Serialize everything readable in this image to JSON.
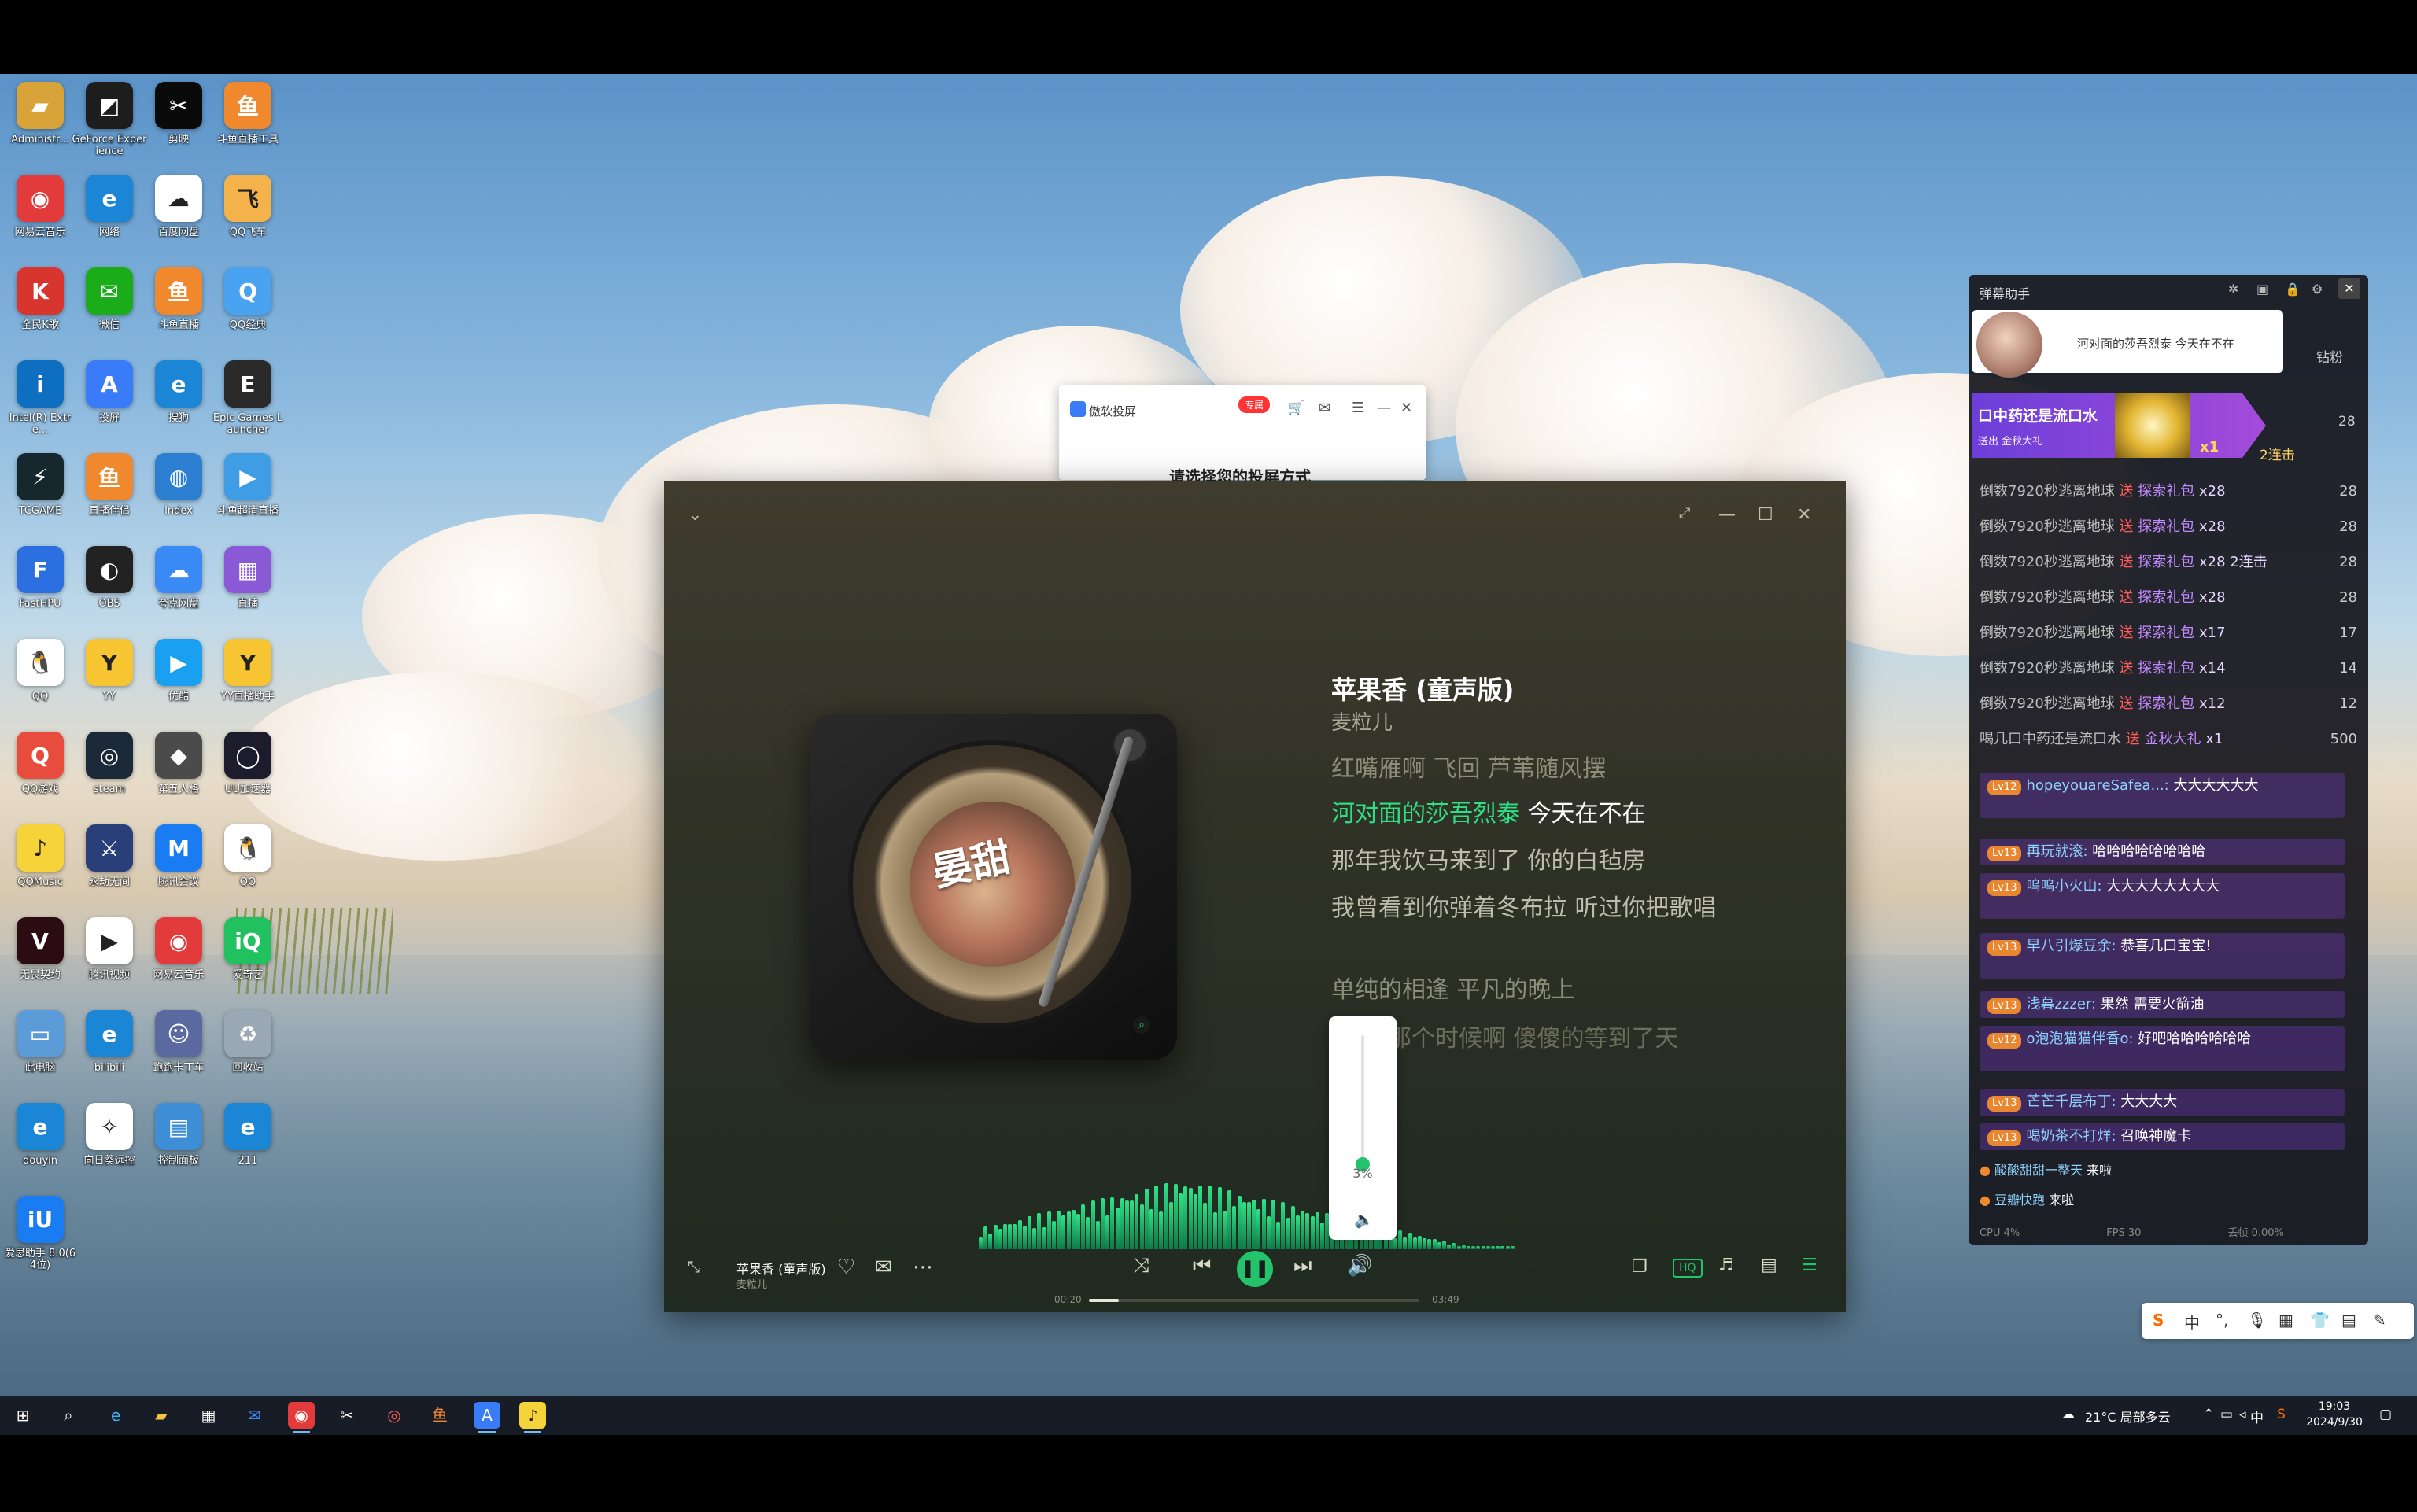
{
  "desktop_icons": [
    {
      "label": "Administr...",
      "icon": "folder-icon",
      "color": "#d8a43a",
      "glyph": "▰"
    },
    {
      "label": "GeForce Experience",
      "icon": "geforce-icon",
      "color": "#1d1d1d",
      "glyph": "◩"
    },
    {
      "label": "剪映",
      "icon": "capcut-icon",
      "color": "#0a0a0a",
      "glyph": "✂"
    },
    {
      "label": "斗鱼直播工具",
      "icon": "douyu-tool-icon",
      "color": "#f0892e",
      "glyph": "鱼"
    },
    {
      "label": "网易云音乐",
      "icon": "netease-music-icon",
      "color": "#e33b3b",
      "glyph": "◉"
    },
    {
      "label": "网络",
      "icon": "edge-icon",
      "color": "#1c86d6",
      "glyph": "e"
    },
    {
      "label": "百度网盘",
      "icon": "baidu-pan-icon",
      "color": "#ffffff",
      "glyph": "☁"
    },
    {
      "label": "QQ飞车",
      "icon": "qq-speed-icon",
      "color": "#f4b24a",
      "glyph": "飞"
    },
    {
      "label": "全民K歌",
      "icon": "game-icon",
      "color": "#d8352f",
      "glyph": "K"
    },
    {
      "label": "微信",
      "icon": "wechat-icon",
      "color": "#1aad19",
      "glyph": "✉"
    },
    {
      "label": "斗鱼直播",
      "icon": "douyu-icon",
      "color": "#f0892e",
      "glyph": "鱼"
    },
    {
      "label": "QQ经典",
      "icon": "qq-classic-icon",
      "color": "#4aa3f0",
      "glyph": "Q"
    },
    {
      "label": "Intel(R) Extre...",
      "icon": "intel-icon",
      "color": "#0e6fc1",
      "glyph": "i"
    },
    {
      "label": "投屏",
      "icon": "cast-icon",
      "color": "#3a7bf7",
      "glyph": "A"
    },
    {
      "label": "搜狗",
      "icon": "edge-icon",
      "color": "#1c86d6",
      "glyph": "e"
    },
    {
      "label": "Epic Games Launcher",
      "icon": "epic-icon",
      "color": "#2a2a2a",
      "glyph": "E"
    },
    {
      "label": "TCGAME",
      "icon": "tcgame-icon",
      "color": "#16282e",
      "glyph": "⚡"
    },
    {
      "label": "直播伴侣",
      "icon": "douyu-icon",
      "color": "#f0892e",
      "glyph": "鱼"
    },
    {
      "label": "Index",
      "icon": "globe-icon",
      "color": "#2c7fd0",
      "glyph": "◍"
    },
    {
      "label": "斗鱼超清直播",
      "icon": "stream-icon",
      "color": "#3f9de6",
      "glyph": "▶"
    },
    {
      "label": "FastHPU",
      "icon": "fast-icon",
      "color": "#2b6fe0",
      "glyph": "F"
    },
    {
      "label": "OBS",
      "icon": "obs-icon",
      "color": "#222222",
      "glyph": "◐"
    },
    {
      "label": "夸克网盘",
      "icon": "cloud-drive-icon",
      "color": "#3a8af5",
      "glyph": "☁"
    },
    {
      "label": "直播",
      "icon": "live-icon",
      "color": "#8a5ad6",
      "glyph": "▦"
    },
    {
      "label": "QQ",
      "icon": "qq-icon",
      "color": "#ffffff",
      "glyph": "🐧"
    },
    {
      "label": "YY",
      "icon": "yy-icon",
      "color": "#f6c531",
      "glyph": "Y"
    },
    {
      "label": "优酷",
      "icon": "video-icon",
      "color": "#1aa0f0",
      "glyph": "▶"
    },
    {
      "label": "YY直播助手",
      "icon": "yy-helper-icon",
      "color": "#f6c531",
      "glyph": "Y"
    },
    {
      "label": "QQ游戏",
      "icon": "qq-game-icon",
      "color": "#e74c3c",
      "glyph": "Q"
    },
    {
      "label": "steam",
      "icon": "steam-icon",
      "color": "#1b2838",
      "glyph": "◎"
    },
    {
      "label": "第五人格",
      "icon": "game-icon",
      "color": "#4b4b4b",
      "glyph": "◆"
    },
    {
      "label": "UU加速器",
      "icon": "uu-icon",
      "color": "#1c1c2c",
      "glyph": "◯"
    },
    {
      "label": "QQMusic",
      "icon": "qq-music-icon",
      "color": "#f7d33a",
      "glyph": "♪"
    },
    {
      "label": "永劫无间",
      "icon": "game-icon",
      "color": "#2a3f7a",
      "glyph": "⚔"
    },
    {
      "label": "腾讯会议",
      "icon": "meeting-icon",
      "color": "#1a7cf3",
      "glyph": "M"
    },
    {
      "label": "QQ",
      "icon": "qq-icon",
      "color": "#ffffff",
      "glyph": "🐧"
    },
    {
      "label": "无畏契约",
      "icon": "valorant-icon",
      "color": "#2a0c12",
      "glyph": "V"
    },
    {
      "label": "腾讯视频",
      "icon": "tencent-video-icon",
      "color": "#ffffff",
      "glyph": "▶"
    },
    {
      "label": "网易云音乐",
      "icon": "netease-music-icon",
      "color": "#e33b3b",
      "glyph": "◉"
    },
    {
      "label": "爱奇艺",
      "icon": "iqiyi-icon",
      "color": "#21c160",
      "glyph": "iQ"
    },
    {
      "label": "此电脑",
      "icon": "computer-icon",
      "color": "#5a9bd8",
      "glyph": "▭"
    },
    {
      "label": "bilibili",
      "icon": "edge-icon",
      "color": "#1c86d6",
      "glyph": "e"
    },
    {
      "label": "跑跑卡丁车",
      "icon": "kart-icon",
      "color": "#5a6aa0",
      "glyph": "☺"
    },
    {
      "label": "回收站",
      "icon": "recycle-bin-icon",
      "color": "#9aa7b5",
      "glyph": "♻"
    },
    {
      "label": "douyin",
      "icon": "edge-icon",
      "color": "#1c86d6",
      "glyph": "e"
    },
    {
      "label": "向日葵远控",
      "icon": "remote-icon",
      "color": "#ffffff",
      "glyph": "✧"
    },
    {
      "label": "控制面板",
      "icon": "control-panel-icon",
      "color": "#3e8ed6",
      "glyph": "▤"
    },
    {
      "label": "211",
      "icon": "edge-icon",
      "color": "#1c86d6",
      "glyph": "e"
    },
    {
      "label": "爱思助手 8.0(64位)",
      "icon": "i4-icon",
      "color": "#1a7cf3",
      "glyph": "iU"
    }
  ],
  "popup": {
    "title": "傲软投屏",
    "badge": "专属",
    "body": "请选择您的投屏方式"
  },
  "player": {
    "song_title": "苹果香 (童声版)",
    "artist": "麦粒儿",
    "record_text": "晏甜",
    "lyrics": [
      {
        "text": "红嘴雁啊 飞回  芦苇随风摆",
        "state": "dim"
      },
      {
        "text_hl": "河对面的莎吾烈泰",
        "text_rest": " 今天在不在",
        "state": "active"
      },
      {
        "text": "那年我饮马来到了 你的白毡房",
        "state": "next"
      },
      {
        "text": "我曾看到你弹着冬布拉 听过你把歌唱",
        "state": "next"
      },
      {
        "text": "单纯的相逢 平凡的晚上",
        "state": "dim"
      },
      {
        "text": "那个时候啊 傻傻的等到了天",
        "state": "fade"
      }
    ],
    "volume": {
      "percent_label": "3%",
      "level": 0.03
    },
    "mini_title": "苹果香 (童声版)",
    "mini_artist": "麦粒儿",
    "time_current": "00:20",
    "time_total": "03:49",
    "progress": 0.09,
    "hq_label": "HQ",
    "accent": "#22c36a"
  },
  "danmaku": {
    "title": "弹幕助手",
    "banner_text": "河对面的莎吾烈泰 今天在不在",
    "side_label": "钻粉",
    "gift_banner": {
      "line1": "口中药还是流口水",
      "line2": "送出  金秋大礼",
      "count": "x1",
      "combo": "2连击",
      "side": "28"
    },
    "gift_rows": [
      {
        "user": "倒数7920秒逃离地球",
        "action": "送",
        "gift": "探索礼包",
        "count": "x28",
        "rank": "28"
      },
      {
        "user": "倒数7920秒逃离地球",
        "action": "送",
        "gift": "探索礼包",
        "count": "x28",
        "rank": "28"
      },
      {
        "user": "倒数7920秒逃离地球",
        "action": "送",
        "gift": "探索礼包",
        "count": "x28 2连击",
        "rank": "28"
      },
      {
        "user": "倒数7920秒逃离地球",
        "action": "送",
        "gift": "探索礼包",
        "count": "x28",
        "rank": "28"
      },
      {
        "user": "倒数7920秒逃离地球",
        "action": "送",
        "gift": "探索礼包",
        "count": "x17",
        "rank": "17"
      },
      {
        "user": "倒数7920秒逃离地球",
        "action": "送",
        "gift": "探索礼包",
        "count": "x14",
        "rank": "14"
      },
      {
        "user": "倒数7920秒逃离地球",
        "action": "送",
        "gift": "探索礼包",
        "count": "x12",
        "rank": "12"
      },
      {
        "user": "喝几口中药还是流口水",
        "action": "送",
        "gift": "金秋大礼",
        "count": "x1",
        "rank": "500"
      }
    ],
    "chats": [
      {
        "badge": "Lv12",
        "name": "hopeyouareSafea...:",
        "msg": " 大大大大大大"
      },
      {
        "badge": "Lv13",
        "name": "再玩就滚:",
        "msg": " 哈哈哈哈哈哈哈哈"
      },
      {
        "badge": "Lv13",
        "name": "呜呜小火山:",
        "msg": " 大大大大大大大大"
      },
      {
        "badge": "Lv13",
        "name": "早八引爆豆余:",
        "msg": " 恭喜几口宝宝!"
      },
      {
        "badge": "Lv13",
        "name": "浅暮zzzer:",
        "msg": " 果然 需要火箭油"
      },
      {
        "badge": "Lv12",
        "name": "o泡泡猫猫伴香o:",
        "msg": " 好吧哈哈哈哈哈哈"
      },
      {
        "badge": "Lv13",
        "name": "芒芒千层布丁:",
        "msg": " 大大大大"
      },
      {
        "badge": "Lv13",
        "name": "喝奶茶不打烊:",
        "msg": " 召唤神魔卡"
      }
    ],
    "enters": [
      {
        "name": "酸酸甜甜一整天",
        "msg": "来啦"
      },
      {
        "name": "豆瓣快跑",
        "msg": "来啦"
      }
    ],
    "footer": {
      "cpu": "CPU 4%",
      "fps": "FPS 30",
      "drop": "丢帧 0.00%"
    }
  },
  "ime": [
    "S",
    "中",
    "°,",
    "🎙",
    "▦",
    "👕",
    "▤",
    "✎"
  ],
  "taskbar": {
    "weather": "21°C  局部多云",
    "lang": "中",
    "time": "19:03",
    "date": "2024/9/30"
  }
}
